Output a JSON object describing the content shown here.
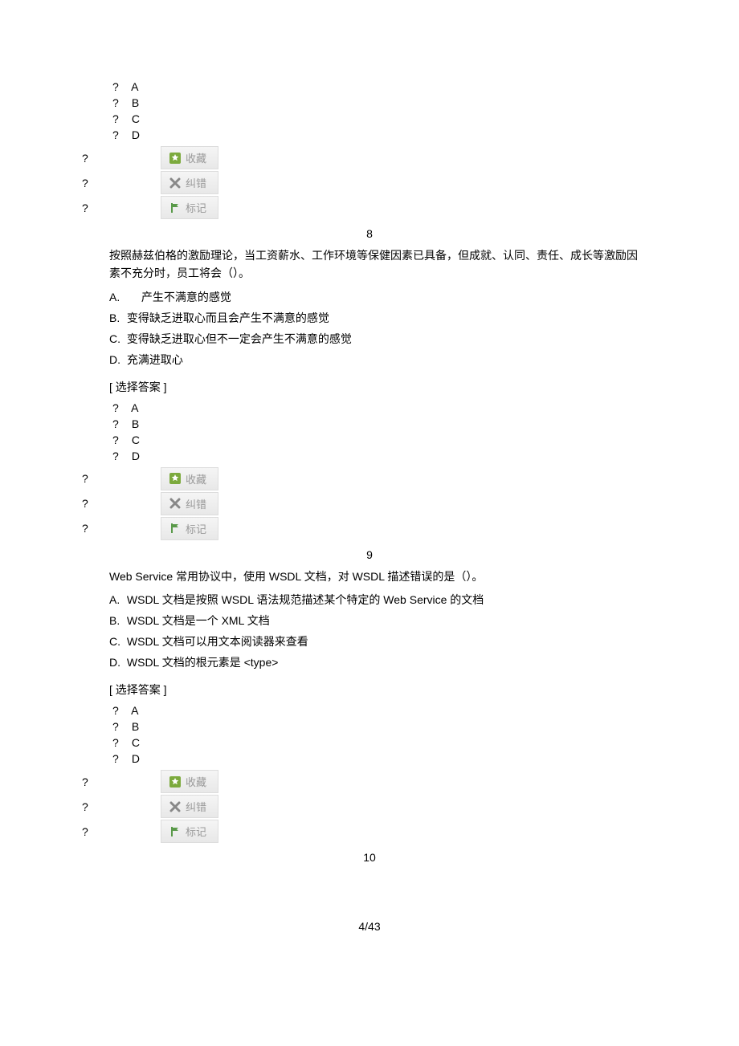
{
  "answerChoices": [
    "A",
    "B",
    "C",
    "D"
  ],
  "qmark": "?",
  "actions": {
    "favorite": "收藏",
    "wrong": "纠错",
    "mark": "标记"
  },
  "q8": {
    "number": "8",
    "text": "按照赫兹伯格的激励理论，当工资薪水、工作环境等保健因素已具备，但成就、认同、责任、成长等激励因素不充分时，员工将会（）。",
    "options": [
      {
        "letter": "A.",
        "text": "产生不满意的感觉",
        "indent": true
      },
      {
        "letter": "B.",
        "text": "变得缺乏进取心而且会产生不满意的感觉",
        "indent": false
      },
      {
        "letter": "C.",
        "text": "变得缺乏进取心但不一定会产生不满意的感觉",
        "indent": false
      },
      {
        "letter": "D.",
        "text": "充满进取心",
        "indent": false
      }
    ],
    "selectLabel": "[ 选择答案 ]"
  },
  "q9": {
    "number": "9",
    "text": "Web Service 常用协议中，使用   WSDL 文档，对 WSDL 描述错误的是（）。",
    "options": [
      {
        "letter": "A.",
        "text": "WSDL 文档是按照  WSDL 语法规范描述某个特定的 Web Service 的文档"
      },
      {
        "letter": "B.",
        "text": "WSDL 文档是一个  XML 文档"
      },
      {
        "letter": "C.",
        "text": "WSDL 文档可以用文本阅读器来查看"
      },
      {
        "letter": "D.",
        "text": "WSDL 文档的根元素是 <type>"
      }
    ],
    "selectLabel": "[ 选择答案 ]"
  },
  "q10": {
    "number": "10"
  },
  "pageNum": "4/43"
}
